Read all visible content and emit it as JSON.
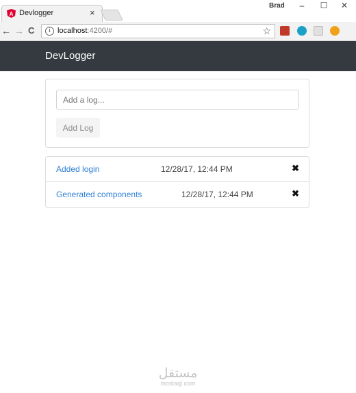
{
  "browser": {
    "tab_title": "Devlogger",
    "tab_close": "×",
    "user_name": "Brad",
    "window_controls": {
      "minimize": "–",
      "maximize": "☐",
      "close": "✕"
    },
    "nav": {
      "back": "←",
      "forward": "→",
      "reload": "C"
    },
    "info_glyph": "i",
    "url_host": "localhost",
    "url_path": ":4200/#",
    "bookmark_glyph": "☆",
    "extensions": [
      "red-chart-icon",
      "teal-circle-icon",
      "grey-square-icon",
      "orange-circle-icon"
    ]
  },
  "navbar": {
    "brand": "DevLogger",
    "background": "#343a40"
  },
  "form": {
    "input_placeholder": "Add a log...",
    "input_value": "",
    "add_button": "Add Log"
  },
  "logs": [
    {
      "text": "Added login",
      "date": "12/28/17, 12:44 PM"
    },
    {
      "text": "Generated components",
      "date": "12/28/17, 12:44 PM"
    }
  ],
  "delete_glyph": "✖",
  "watermark": {
    "arabic": "مستقل",
    "latin": "mostaql.com"
  },
  "colors": {
    "link": "#2f7fd6",
    "navbar": "#343a40"
  }
}
